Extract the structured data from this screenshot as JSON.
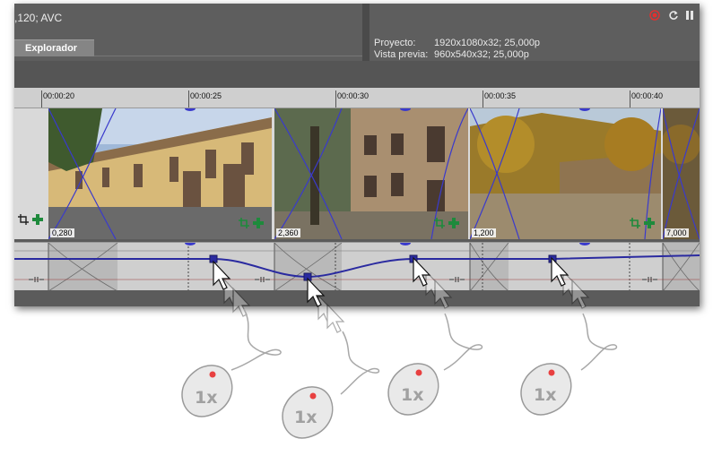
{
  "header": {
    "codec_text": ",120; AVC",
    "tab_explorer": "Explorador"
  },
  "properties": {
    "project_label": "Proyecto:",
    "project_value": "1920x1080x32; 25,000p",
    "preview_label": "Vista previa:",
    "preview_value": "960x540x32; 25,000p"
  },
  "ruler": {
    "ticks": [
      "00:00:20",
      "00:00:25",
      "00:00:30",
      "00:00:35",
      "00:00:40"
    ]
  },
  "clips": [
    {
      "offset": "0,280"
    },
    {
      "offset": "2,360"
    },
    {
      "offset": "1,200"
    },
    {
      "offset": "7,000"
    }
  ],
  "annotations": {
    "click_count": [
      "1x",
      "1x",
      "1x",
      "1x"
    ]
  },
  "colors": {
    "envelope": "#2a2aa0",
    "fade_curve": "#3a3acc",
    "record_red": "#e03030",
    "marker_green": "#1e8a3c"
  }
}
